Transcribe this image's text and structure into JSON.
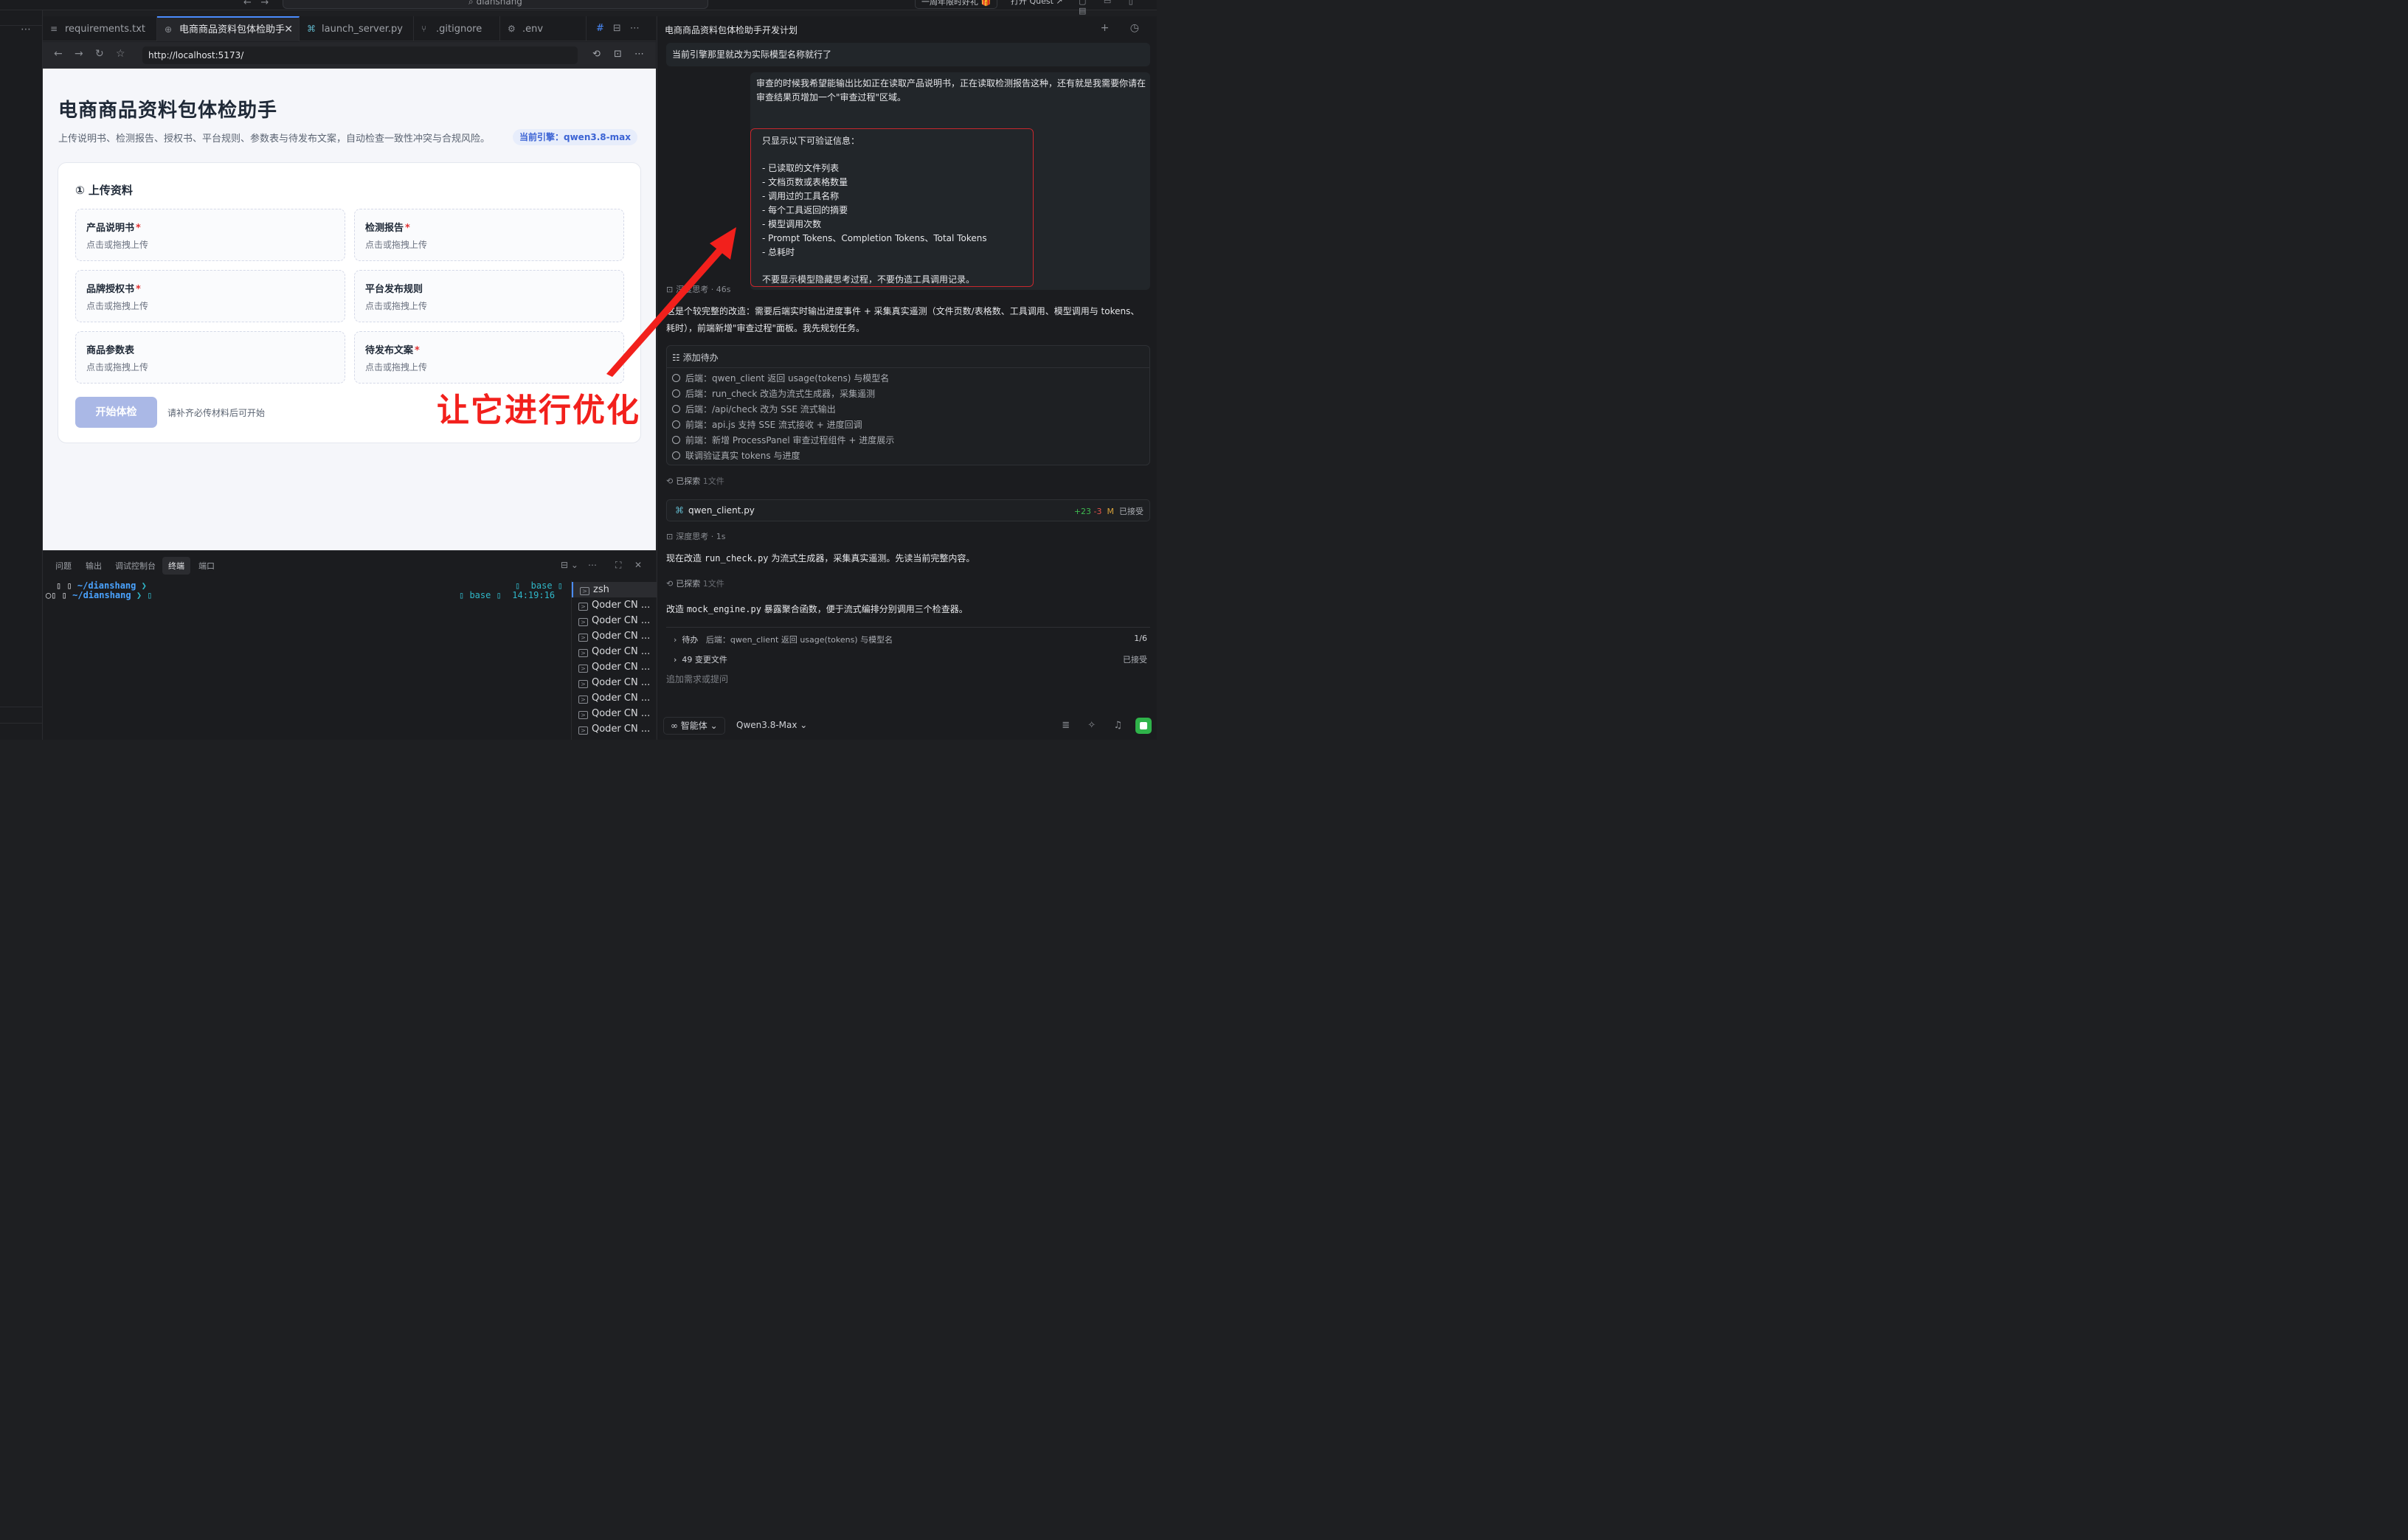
{
  "topbar": {
    "nav_back": "←",
    "nav_forward": "→",
    "search": "⌕ dianshang",
    "promo": "一周年限时好礼 🎁",
    "quest": "打开 Quest ↗",
    "window_icons": "▢ ▭ ▯ ▤"
  },
  "activity": {
    "more": "⋯"
  },
  "tabs": [
    {
      "icon": "≡",
      "label": "requirements.txt"
    },
    {
      "icon": "⊕",
      "label": "电商商品资料包体检助手",
      "close": "✕"
    },
    {
      "icon": "⌘",
      "label": "launch_server.py"
    },
    {
      "icon": "⑂",
      "label": ".gitignore"
    },
    {
      "icon": "⚙",
      "label": ".env"
    }
  ],
  "tab_actions": {
    "hash": "#",
    "split": "⊟",
    "more": "⋯"
  },
  "browser": {
    "back": "←",
    "forward": "→",
    "reload": "↻",
    "star": "☆",
    "url": "http://localhost:5173/",
    "right_icons": [
      "⟲",
      "⊡",
      "⋯"
    ]
  },
  "app": {
    "title": "电商商品资料包体检助手",
    "subtitle": "上传说明书、检测报告、授权书、平台规则、参数表与待发布文案，自动检查一致性冲突与合规风险。",
    "engine": "当前引擎：qwen3.8-max",
    "upload_title": "① 上传资料",
    "slots": [
      {
        "name": "产品说明书",
        "required": "*",
        "hint": "点击或拖拽上传"
      },
      {
        "name": "检测报告",
        "required": "*",
        "hint": "点击或拖拽上传"
      },
      {
        "name": "品牌授权书",
        "required": "*",
        "hint": "点击或拖拽上传"
      },
      {
        "name": "平台发布规则",
        "required": "",
        "hint": "点击或拖拽上传"
      },
      {
        "name": "商品参数表",
        "required": "",
        "hint": "点击或拖拽上传"
      },
      {
        "name": "待发布文案",
        "required": "*",
        "hint": "点击或拖拽上传"
      }
    ],
    "start_button": "开始体检",
    "start_hint": "请补齐必传材料后可开始"
  },
  "annotation": "让它进行优化",
  "colors": {
    "annotation": "#f2201c",
    "accent": "#4a8cff",
    "start_button": "#aab8e6",
    "engine_text": "#3b63d4"
  },
  "panel": {
    "tabs": [
      "问题",
      "输出",
      "调试控制台",
      "终端",
      "端口"
    ],
    "active_tab": "终端",
    "actions": [
      "⊟ ⌄",
      "⋯",
      "⛶",
      "✕"
    ],
    "terminal": {
      "line1_prompt": "▯ ▯ ",
      "line1_path": "~/dianshang",
      "line1_chevron": " ❯",
      "line2_prompt": "◯▯ ▯ ",
      "line2_path": "~/dianshang",
      "line2_chevron": " ❯ ▯",
      "right1": "▯  base ▯",
      "right2": "▯ base ▯  14:19:16"
    },
    "sessions": [
      "zsh",
      "Qoder CN ...",
      "Qoder CN ...",
      "Qoder CN ...",
      "Qoder CN ...",
      "Qoder CN ...",
      "Qoder CN ...",
      "Qoder CN ...",
      "Qoder CN ...",
      "Qoder CN ..."
    ]
  },
  "chat": {
    "title": "电商商品资料包体检助手开发计划",
    "head_icons": "+ ◷",
    "message1": "当前引擎那里就改为实际模型名称就行了",
    "message2": "审查的时候我希望能输出比如正在读取产品说明书，正在读取检测报告这种，还有就是我需要你请在审查结果页增加一个\"审查过程\"区域。",
    "box_lines": [
      "只显示以下可验证信息：",
      "",
      "- 已读取的文件列表",
      "- 文档页数或表格数量",
      "- 调用过的工具名称",
      "- 每个工具返回的摘要",
      "- 模型调用次数",
      "- Prompt Tokens、Completion Tokens、Total Tokens",
      "- 总耗时",
      "",
      "不要显示模型隐藏思考过程，不要伪造工具调用记录。"
    ],
    "think1": "深度思考 · 46s",
    "reply1": "这是个较完整的改造：需要后端实时输出进度事件 + 采集真实遥测（文件页数/表格数、工具调用、模型调用与 tokens、耗时），前端新增\"审查过程\"面板。我先规划任务。",
    "todo_title": "添加待办",
    "todos": [
      "后端：qwen_client 返回 usage(tokens) 与模型名",
      "后端：run_check 改造为流式生成器，采集遥测",
      "后端：/api/check 改为 SSE 流式输出",
      "前端：api.js 支持 SSE 流式接收 + 进度回调",
      "前端：新增 ProcessPanel 审查过程组件 + 进度展示",
      "联调验证真实 tokens 与进度"
    ],
    "explored1": "已探索",
    "explored1_count": "1文件",
    "file_name": "qwen_client.py",
    "file_added": "+23",
    "file_removed": "-3",
    "file_mod": "M",
    "file_status": "已接受",
    "think2": "深度思考 · 1s",
    "reply2_pre": "现在改造 ",
    "reply2_code": "run_check.py",
    "reply2_post": " 为流式生成器，采集真实遥测。先读当前完整内容。",
    "explored2": "已探索",
    "explored2_count": "1文件",
    "reply3_pre": "改造 ",
    "reply3_code": "mock_engine.py",
    "reply3_post": " 暴露聚合函数，便于流式编排分别调用三个检查器。",
    "pending_label": "待办",
    "pending_item": "后端：qwen_client 返回 usage(tokens) 与模型名",
    "pending_count": "1/6",
    "changed_files": "49 变更文件",
    "changed_status": "已接受",
    "input_placeholder": "追加需求或提问",
    "mode": "∞  智能体  ⌄",
    "model": "Qwen3.8-Max  ⌄",
    "foot_icons": "≣ ✧ ♫"
  }
}
